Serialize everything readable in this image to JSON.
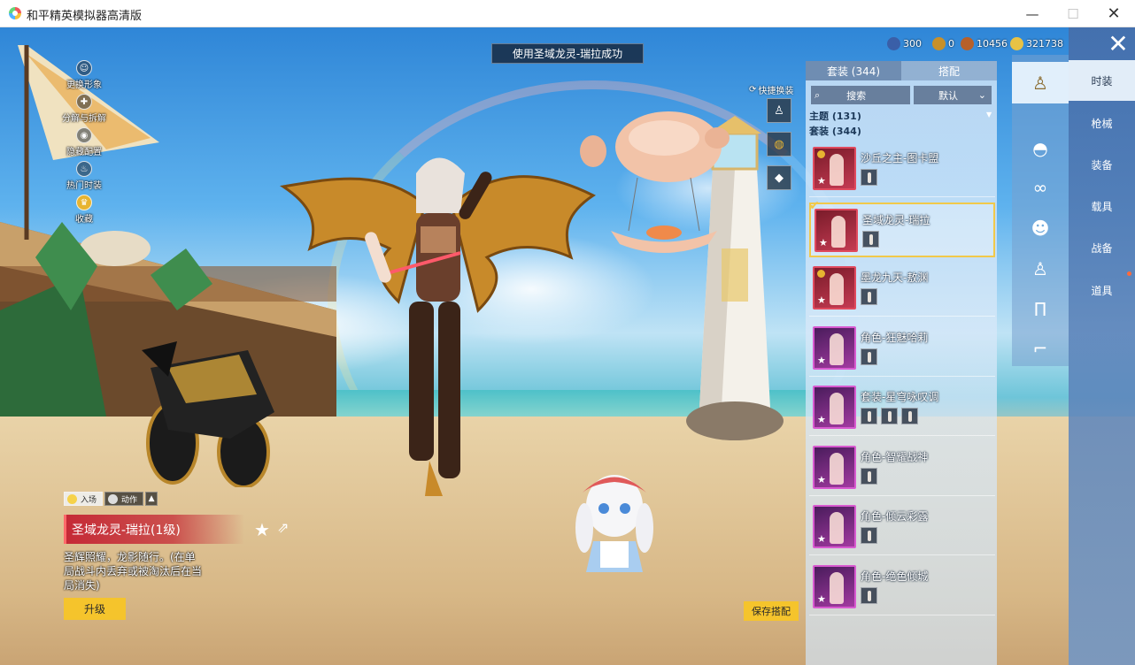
{
  "window": {
    "title": "和平精英模拟器高清版",
    "minimize": "—",
    "maximize": "☐",
    "close": "✕"
  },
  "toast": "使用圣域龙灵-瑞拉成功",
  "quick_menu": [
    {
      "label": "更换形象",
      "icon": "avatar-icon"
    },
    {
      "label": "分解与拆解",
      "icon": "dismantle-icon"
    },
    {
      "label": "隐藏配置",
      "icon": "eye-icon"
    },
    {
      "label": "热门时装",
      "icon": "fire-icon"
    },
    {
      "label": "收藏",
      "icon": "crown-icon"
    }
  ],
  "currency": [
    {
      "value": "300",
      "icon": "globe-coin-icon",
      "color": "#3a5fa8"
    },
    {
      "value": "0",
      "icon": "gold-token-icon",
      "color": "#c8902a"
    },
    {
      "value": "10456",
      "icon": "bronze-coin-icon",
      "color": "#b7602a"
    },
    {
      "value": "321738",
      "icon": "silver-coin-icon",
      "color": "#e8c245"
    }
  ],
  "quick_switch": {
    "label": "快捷换装"
  },
  "panel": {
    "tabs": [
      "套装 (344)",
      "搭配"
    ],
    "search_label": "搜索",
    "sort_label": "默认",
    "group_theme": "主题 (131)",
    "group_sets": "套装 (344)",
    "items": [
      {
        "name": "沙丘之主-图卡盟",
        "frame": "red",
        "badge": true,
        "subs": 1
      },
      {
        "name": "圣域龙灵-瑞拉",
        "frame": "red",
        "badge": false,
        "subs": 1,
        "selected": true
      },
      {
        "name": "墨龙九天-敖渊",
        "frame": "red",
        "badge": true,
        "subs": 1
      },
      {
        "name": "角色-狂魅哈莉",
        "frame": "pink",
        "badge": false,
        "subs": 1
      },
      {
        "name": "套装-星穹咏叹调",
        "frame": "pink",
        "badge": false,
        "subs": 3
      },
      {
        "name": "角色-智耀战神",
        "frame": "pink",
        "badge": false,
        "subs": 1
      },
      {
        "name": "角色-倾云彩露",
        "frame": "pink",
        "badge": false,
        "subs": 1
      },
      {
        "name": "角色-绝色倾城",
        "frame": "pink",
        "badge": false,
        "subs": 1
      }
    ]
  },
  "categories": [
    "outfit-icon",
    "cap-icon",
    "glasses-icon",
    "mask-icon",
    "top-icon",
    "pants-icon",
    "shoes-icon"
  ],
  "side_nav": [
    "时装",
    "枪械",
    "装备",
    "载具",
    "战备",
    "道具"
  ],
  "detail": {
    "tab_entry": "入场",
    "tab_action": "动作",
    "title": "圣域龙灵-瑞拉(1级)",
    "description": "圣辉照耀，龙影随行。(在单局战斗内丢弃或被淘汰后在当局消失)",
    "upgrade": "升级",
    "save": "保存搭配"
  }
}
